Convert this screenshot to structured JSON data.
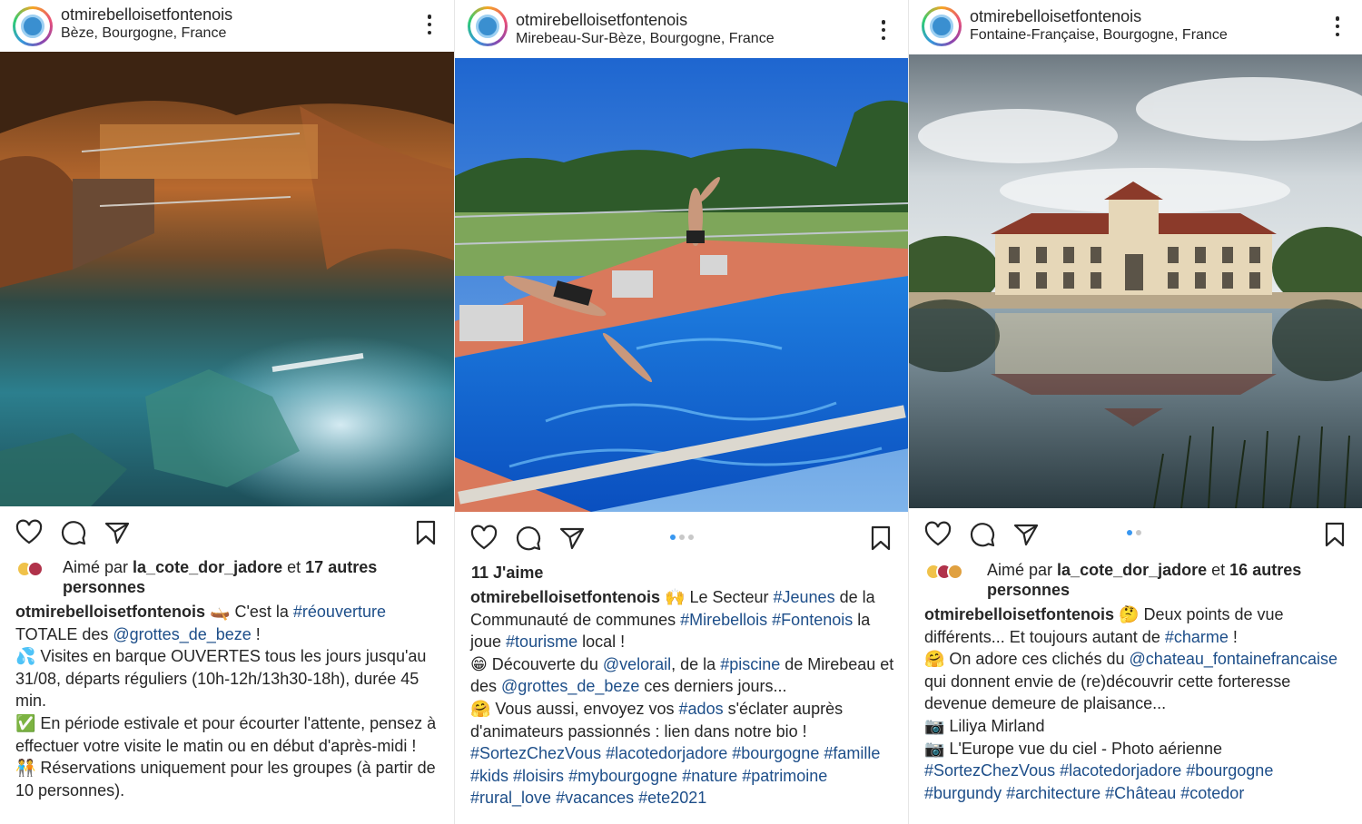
{
  "posts": [
    {
      "username": "otmirebelloisetfontenois",
      "location": "Bèze, Bourgogne, France",
      "photo": "underground cave lake with boat dock and lit rock walls",
      "liked_by_prefix": "Aimé par",
      "liked_by_user": "la_cote_dor_jadore",
      "liked_by_and": "et",
      "liked_by_others": "17 autres personnes",
      "caption": [
        [
          "otmirebelloisetfontenois",
          " 🛶 C'est la ",
          "#réouverture"
        ],
        [
          "TOTALE des ",
          "@grottes_de_beze",
          " !"
        ],
        [
          "💦 Visites en barque OUVERTES tous les jours jusqu'au 31/08, départs réguliers (10h-12h/13h30-18h), durée 45 min."
        ],
        [
          "✅ En période estivale et pour écourter l'attente, pensez à effectuer votre visite le matin ou en début d'après-midi !"
        ],
        [
          "🧑‍🤝‍🧑 Réservations uniquement pour les groupes (à partir de 10 personnes)."
        ]
      ]
    },
    {
      "username": "otmirebelloisetfontenois",
      "location": "Mirebeau-Sur-Bèze, Bourgogne, France",
      "photo": "outdoor swimming pool with two boys diving",
      "likes": "11 J'aime",
      "caption": [
        [
          "otmirebelloisetfontenois",
          " 🙌 Le Secteur ",
          "#Jeunes",
          " de la Communauté de communes ",
          "#Mirebellois",
          " ",
          "#Fontenois",
          " la joue ",
          "#tourisme",
          " local !"
        ],
        [
          "😁 Découverte du ",
          "@velorail",
          ", de la ",
          "#piscine",
          " de Mirebeau et des ",
          "@grottes_de_beze",
          " ces derniers jours..."
        ],
        [
          "🤗 Vous aussi, envoyez vos ",
          "#ados",
          " s'éclater auprès d'animateurs passionnés : lien dans notre bio !"
        ],
        [
          "#SortezChezVous",
          " ",
          "#lacotedorjadore",
          " ",
          "#bourgogne",
          " ",
          "#famille",
          " ",
          "#kids",
          " ",
          "#loisirs",
          " ",
          "#mybourgogne",
          " ",
          "#nature",
          " ",
          "#patrimoine",
          " ",
          "#rural_love",
          " ",
          "#vacances",
          " ",
          "#ete2021"
        ]
      ]
    },
    {
      "username": "otmirebelloisetfontenois",
      "location": "Fontaine-Française, Bourgogne, France",
      "photo": "château reflected in a lake under cloudy sky",
      "liked_by_prefix": "Aimé par",
      "liked_by_user": "la_cote_dor_jadore",
      "liked_by_and": "et",
      "liked_by_others": "16 autres personnes",
      "caption": [
        [
          "otmirebelloisetfontenois",
          " 🤔 Deux points de vue différents... Et toujours autant de ",
          "#charme",
          " !"
        ],
        [
          "🤗 On adore ces clichés du ",
          "@chateau_fontainefrancaise",
          " qui donnent envie de (re)découvrir cette forteresse devenue demeure de plaisance..."
        ],
        [
          "📷 Liliya Mirland"
        ],
        [
          "📷 L'Europe vue du ciel - Photo aérienne"
        ],
        [
          "#SortezChezVous",
          " ",
          "#lacotedorjadore",
          " ",
          "#bourgogne",
          " ",
          "#burgundy",
          " ",
          "#architecture",
          " ",
          "#Château",
          " ",
          "#cotedor"
        ]
      ]
    }
  ],
  "colors": {
    "link": "#1d4e89",
    "text": "#262626",
    "dot_active": "#3897f0",
    "dot_inactive": "#c8c8c8"
  },
  "icons": [
    "heart-icon",
    "comment-icon",
    "share-icon",
    "bookmark-icon",
    "more-options-icon"
  ]
}
